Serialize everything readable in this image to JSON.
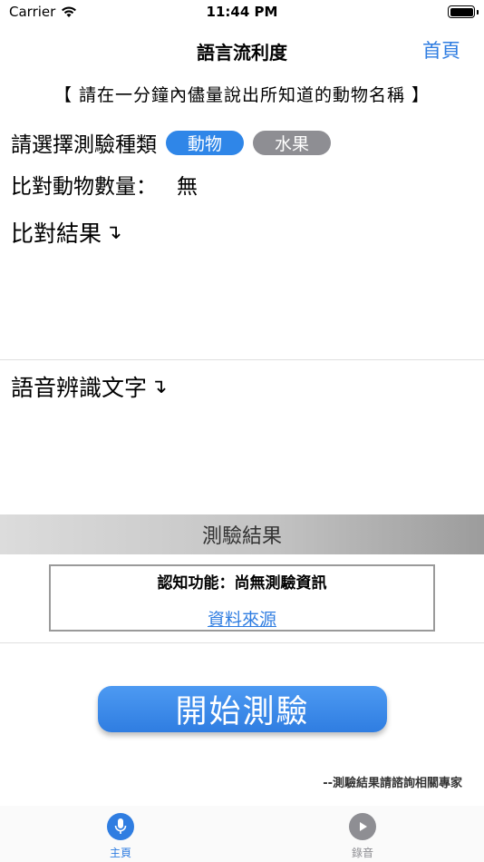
{
  "status_bar": {
    "carrier": "Carrier",
    "time": "11:44 PM"
  },
  "nav": {
    "title": "語言流利度",
    "home_label": "首頁"
  },
  "instruction": "【 請在一分鐘內儘量說出所知道的動物名稱 】",
  "test_type": {
    "label": "請選擇測驗種類",
    "options": [
      {
        "label": "動物",
        "selected": true
      },
      {
        "label": "水果",
        "selected": false
      }
    ]
  },
  "count": {
    "label": "比對動物數量：",
    "value": "無"
  },
  "compare_section": {
    "title": "比對結果",
    "arrow": "↴"
  },
  "speech_section": {
    "title": "語音辨識文字",
    "arrow": "↴"
  },
  "result": {
    "banner": "測驗結果",
    "cognitive": "認知功能：尚無測驗資訊",
    "source_link": "資料來源"
  },
  "start_button": "開始測驗",
  "disclaimer": "--測驗結果請諮詢相關專家",
  "tabs": [
    {
      "label": "主頁",
      "icon": "microphone-icon",
      "active": true
    },
    {
      "label": "錄音",
      "icon": "play-icon",
      "active": false
    }
  ],
  "colors": {
    "accent": "#2f7de1",
    "inactive": "#8e8e93",
    "chip_active": "#2f86e8"
  }
}
